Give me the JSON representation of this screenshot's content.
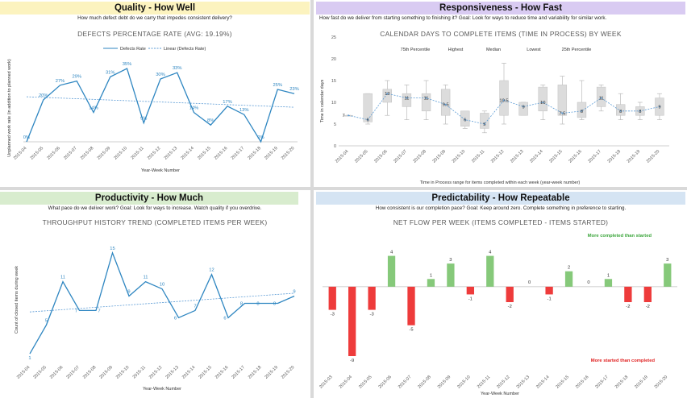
{
  "panels": {
    "quality": {
      "title": "Quality - How Well",
      "subtitle": "How much defect debt do we carry that impedes consistent delivery?",
      "banner_color": "#fcf3bf"
    },
    "responsiveness": {
      "title": "Responsiveness - How Fast",
      "subtitle": "How fast do we deliver from starting something to finishing it? Goal: Look for ways to reduce time and variability for similar work.",
      "banner_color": "#d9cbf2"
    },
    "productivity": {
      "title": "Productivity - How Much",
      "subtitle": "What pace do we deliver work? Goal: Look for ways to increase. Watch quality if you overdrive.",
      "banner_color": "#d8ecce"
    },
    "predictability": {
      "title": "Predictability - How Repeatable",
      "subtitle": "How consistent is our completion pace? Goal: Keep around zero. Complete something in preference to starting.",
      "banner_color": "#d5e4f3"
    }
  },
  "chart_data": [
    {
      "type": "line",
      "title": "DEFECTS PERCENTAGE RATE (AVG: 19.19%)",
      "xlabel": "Year-Week Number",
      "ylabel": "Unplanned work rate (in addition to planned work)",
      "categories": [
        "2015-04",
        "2015-05",
        "2015-06",
        "2015-07",
        "2015-08",
        "2015-09",
        "2015-10",
        "2015-11",
        "2015-12",
        "2015-13",
        "2015-14",
        "2015-15",
        "2015-16",
        "2015-17",
        "2015-18",
        "2015-19",
        "2015-20"
      ],
      "series": [
        {
          "name": "Defects Rate",
          "values": [
            0,
            20,
            27,
            29,
            14,
            31,
            35,
            9,
            30,
            33,
            14,
            8,
            17,
            13,
            0,
            25,
            23
          ],
          "labels": [
            "0%",
            "20%",
            "27%",
            "29%",
            "14%",
            "31%",
            "35%",
            "9%",
            "30%",
            "33%",
            "14%",
            "8%",
            "17%",
            "13%",
            "0%",
            "25%",
            "23%"
          ],
          "color": "#2e86c1"
        },
        {
          "name": "Linear (Defects Rate)",
          "trend": [
            21.5,
            16.5
          ],
          "color": "#5b9bd5"
        }
      ],
      "ylim": [
        0,
        40
      ]
    },
    {
      "type": "box",
      "title": "CALENDAR DAYS TO COMPLETE ITEMS (TIME IN PROCESS) BY WEEK",
      "ylabel": "Time in calendar days",
      "footer": "Time in Process range for items completed within each week (year-week number)",
      "legend": [
        "75th Percentile",
        "Highest",
        "Median",
        "Lowest",
        "25th Percentile"
      ],
      "categories": [
        "2015-04",
        "2015-05",
        "2015-06",
        "2015-07",
        "2015-08",
        "2015-09",
        "2015-10",
        "2015-11",
        "2015-12",
        "2015-13",
        "2015-14",
        "2015-15",
        "2015-16",
        "2015-17",
        "2015-18",
        "2015-19",
        "2015-20"
      ],
      "yticks": [
        "0",
        "5",
        "10",
        "15",
        "20",
        "25"
      ],
      "ylim": [
        0,
        25
      ],
      "median": [
        7,
        6,
        12,
        11,
        11,
        9.5,
        6,
        5,
        10.5,
        9,
        10,
        7.5,
        8,
        11,
        8,
        8,
        9
      ],
      "median_labels": [
        "7",
        "6",
        "12",
        "11",
        "11",
        "9.5",
        "6",
        "5",
        "10.5",
        "9",
        "10",
        "7.5",
        "8",
        "11",
        "8",
        "8",
        "9"
      ],
      "q1": [
        7,
        5.5,
        10,
        9,
        8,
        7,
        4.5,
        4,
        7,
        7,
        8,
        7,
        6.5,
        9,
        7,
        7,
        7
      ],
      "q3": [
        7,
        12,
        13,
        12,
        12,
        13,
        8,
        7.5,
        15,
        10,
        13.5,
        14,
        10,
        13.5,
        9.5,
        9,
        11
      ],
      "low": [
        7,
        5,
        7,
        6,
        6,
        5,
        4,
        3,
        5,
        7,
        6,
        5,
        6,
        8,
        6,
        6,
        6
      ],
      "high": [
        7,
        12,
        15,
        14,
        15,
        14,
        8,
        8,
        19,
        10,
        14,
        16,
        15,
        14,
        12,
        10,
        12
      ]
    },
    {
      "type": "line",
      "title": "THROUGHPUT  HISTORY TREND (COMPLETED ITEMS PER WEEK)",
      "xlabel": "Year-Week Number",
      "ylabel": "Count of closed items during week",
      "categories": [
        "2015-04",
        "2015-05",
        "2015-06",
        "2015-07",
        "2015-08",
        "2015-09",
        "2015-10",
        "2015-11",
        "2015-12",
        "2015-13",
        "2015-14",
        "2015-15",
        "2015-16",
        "2015-17",
        "2015-18",
        "2015-19",
        "2015-20"
      ],
      "series": [
        {
          "values": [
            1,
            5,
            11,
            7,
            7,
            15,
            9,
            11,
            10,
            6,
            7,
            12,
            6,
            8,
            8,
            8,
            9
          ],
          "color": "#2e86c1"
        },
        {
          "trend": [
            6.8,
            9.4
          ],
          "color": "#5b9bd5"
        }
      ],
      "ylim": [
        0,
        17
      ]
    },
    {
      "type": "bar",
      "title": "NET FLOW PER WEEK (ITEMS COMPLETED - ITEMS STARTED)",
      "xlabel": "Year-Week Number",
      "categories": [
        "2015-03",
        "2015-04",
        "2015-05",
        "2015-06",
        "2015-07",
        "2015-08",
        "2015-09",
        "2015-10",
        "2015-11",
        "2015-12",
        "2015-13",
        "2015-14",
        "2015-15",
        "2015-16",
        "2015-17",
        "2015-18",
        "2015-19",
        "2015-20"
      ],
      "values": [
        -3,
        -9,
        -3,
        4,
        -5,
        1,
        3,
        -1,
        4,
        -2,
        0,
        -1,
        2,
        0,
        1,
        -2,
        -2,
        3
      ],
      "annotations": {
        "positive": "More completed than started",
        "negative": "More started than completed"
      },
      "positive_color": "#86c97a",
      "negative_color": "#ee3b3b",
      "ylim": [
        -9,
        5
      ]
    }
  ]
}
